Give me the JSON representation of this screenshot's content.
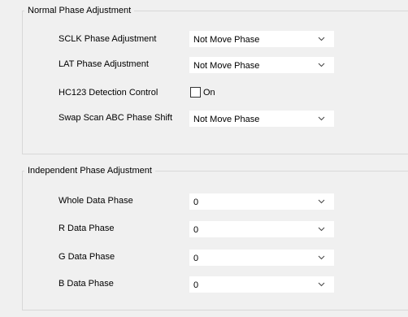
{
  "normal_phase": {
    "title": "Normal Phase Adjustment",
    "sclk": {
      "label": "SCLK Phase Adjustment",
      "value": "Not Move Phase"
    },
    "lat": {
      "label": "LAT Phase Adjustment",
      "value": "Not Move Phase"
    },
    "hc123": {
      "label": "HC123 Detection Control",
      "checkbox_label": "On",
      "checked": false
    },
    "swap": {
      "label": "Swap Scan ABC Phase Shift",
      "value": "Not Move Phase"
    }
  },
  "independent_phase": {
    "title": "Independent Phase Adjustment",
    "whole": {
      "label": "Whole Data Phase",
      "value": "0"
    },
    "r": {
      "label": "R Data Phase",
      "value": "0"
    },
    "g": {
      "label": "G Data Phase",
      "value": "0"
    },
    "b": {
      "label": "B Data Phase",
      "value": "0"
    }
  },
  "icons": {
    "dropdown": "chevron-down-icon"
  }
}
